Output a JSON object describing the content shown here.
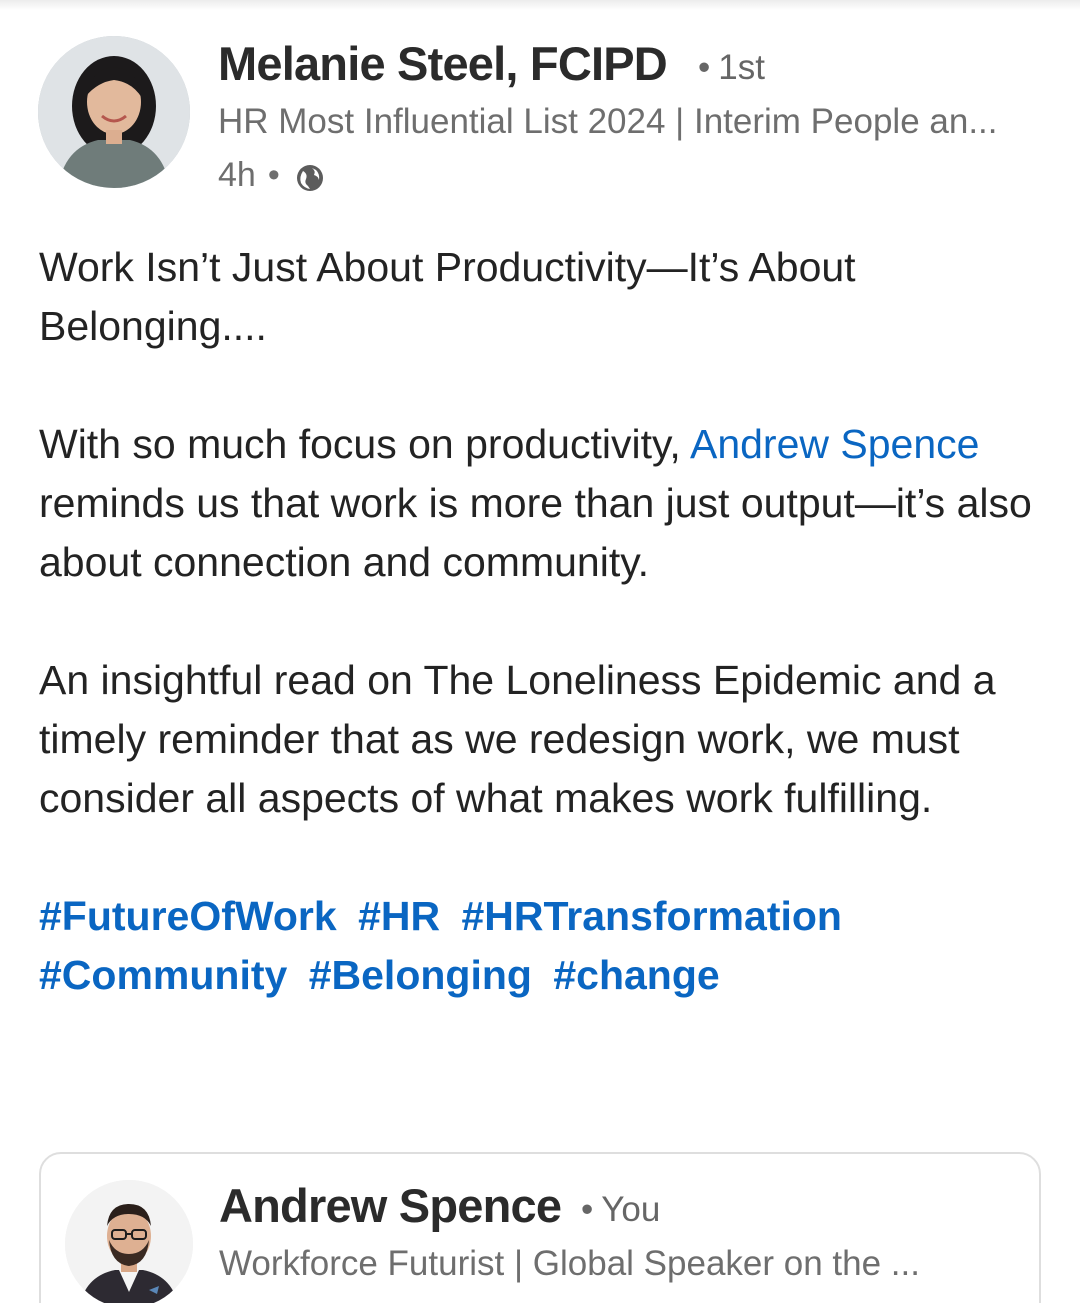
{
  "post": {
    "author": {
      "name": "Melanie Steel, FCIPD",
      "degree": "1st",
      "headline": "HR Most Influential List 2024 | Interim People an...",
      "time": "4h",
      "visibility_icon": "globe-icon"
    },
    "body": {
      "title_line": "Work Isn’t Just About Productivity—It’s About Belonging....",
      "para2_before": "With so much focus on productivity, ",
      "para2_mention": "Andrew Spence",
      "para2_after": " reminds us that work is more than just output—it’s also about connection and community.",
      "para3": "An insightful read on The Loneliness Epidemic and a timely reminder that as we redesign work, we must consider all aspects of what makes work fulfilling."
    },
    "hashtags": [
      "#FutureOfWork",
      "#HR",
      "#HRTransformation",
      "#Community",
      "#Belonging",
      "#change"
    ]
  },
  "shared": {
    "name": "Andrew Spence",
    "relation": "You",
    "headline": "Workforce Futurist | Global Speaker on the ..."
  },
  "colors": {
    "link": "#0a66c2",
    "text": "#232323",
    "muted": "#6e6e6e"
  }
}
